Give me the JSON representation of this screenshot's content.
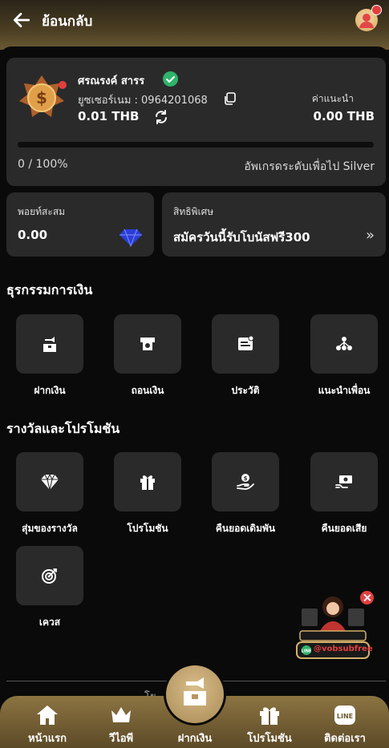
{
  "header": {
    "back_label": "ย้อนกลับ"
  },
  "profile": {
    "name": "ศรณรงค์ สารร",
    "username": "ยูซเซอร์เนม : 0964201068",
    "balance": "0.01 THB",
    "referral_label": "ค่าแนะนำ",
    "referral_value": "0.00 THB",
    "progress_fraction": 0,
    "progress_text": "0 / 100%",
    "upgrade_text": "อัพเกรดระดับเพื่อไป Silver"
  },
  "points": {
    "label": "พอยท์สะสม",
    "value": "0.00"
  },
  "privilege": {
    "label": "สิทธิพิเศษ",
    "value": "สมัครวันนี้รับโบนัสฟรี300",
    "arrow": "»"
  },
  "finance": {
    "title": "ธุรกรรมการเงิน",
    "items": [
      {
        "label": "ฝากเงิน",
        "icon": "deposit-icon"
      },
      {
        "label": "ถอนเงิน",
        "icon": "withdraw-icon"
      },
      {
        "label": "ประวัติ",
        "icon": "history-icon"
      },
      {
        "label": "แนะนำเพื่อน",
        "icon": "refer-friend-icon"
      }
    ]
  },
  "rewards": {
    "title": "รางวัลและโปรโมชัน",
    "items": [
      {
        "label": "สุ่มของรางวัล",
        "icon": "diamond-icon"
      },
      {
        "label": "โปรโมชัน",
        "icon": "gift-icon"
      },
      {
        "label": "คืนยอดเดิมพัน",
        "icon": "cashback-icon"
      },
      {
        "label": "คืนยอดเสีย",
        "icon": "loss-return-icon"
      },
      {
        "label": "เควส",
        "icon": "target-icon"
      }
    ]
  },
  "footer_partial": "โย...ยเท...",
  "bottom_nav": [
    {
      "label": "หน้าแรก",
      "icon": "home-icon"
    },
    {
      "label": "วีไอพี",
      "icon": "crown-icon"
    },
    {
      "label": "ฝากเงิน",
      "icon": "deposit-icon"
    },
    {
      "label": "โปรโมชัน",
      "icon": "gift-icon"
    },
    {
      "label": "ติดต่อเรา",
      "icon": "line-icon"
    }
  ],
  "floating_promo": {
    "line_id": "@vobsubfree"
  },
  "colors": {
    "accent": "#d4b06a",
    "card": "#2a2a2a",
    "background": "#0a0a0a",
    "alert": "#e33f3f",
    "verified": "#2fb36b"
  }
}
